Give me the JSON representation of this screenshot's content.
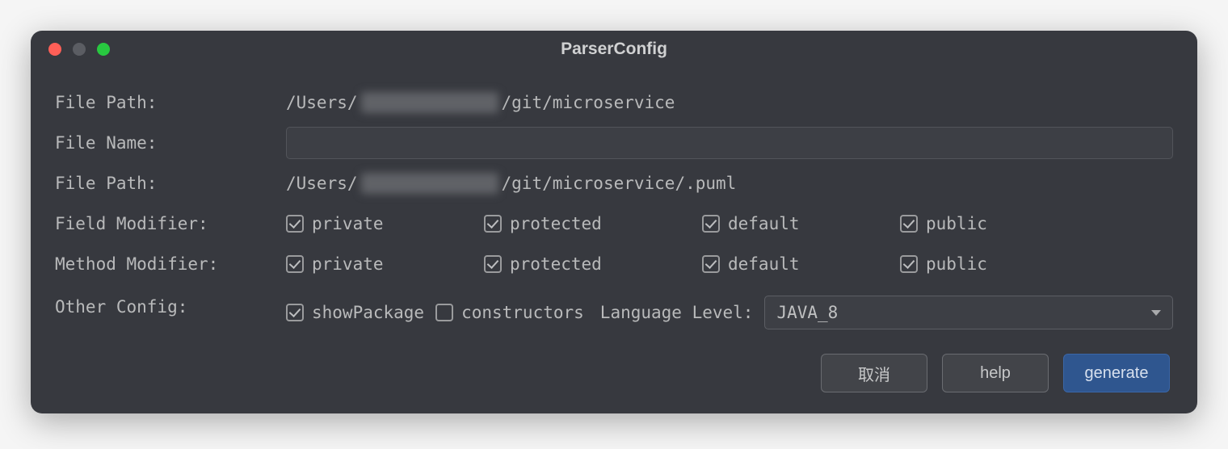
{
  "window": {
    "title": "ParserConfig"
  },
  "form": {
    "file_path_1": {
      "label": "File Path:",
      "prefix": "/Users/",
      "suffix": "/git/microservice"
    },
    "file_name": {
      "label": "File Name:",
      "value": ""
    },
    "file_path_2": {
      "label": "File Path:",
      "prefix": "/Users/",
      "suffix": "/git/microservice/.puml"
    },
    "field_modifier": {
      "label": "Field Modifier:",
      "options": [
        {
          "label": "private",
          "checked": true
        },
        {
          "label": "protected",
          "checked": true
        },
        {
          "label": "default",
          "checked": true
        },
        {
          "label": "public",
          "checked": true
        }
      ]
    },
    "method_modifier": {
      "label": "Method Modifier:",
      "options": [
        {
          "label": "private",
          "checked": true
        },
        {
          "label": "protected",
          "checked": true
        },
        {
          "label": "default",
          "checked": true
        },
        {
          "label": "public",
          "checked": true
        }
      ]
    },
    "other_config": {
      "label": "Other Config:",
      "show_package": {
        "label": "showPackage",
        "checked": true
      },
      "constructors": {
        "label": "constructors",
        "checked": false
      },
      "language_level": {
        "label": "Language Level:",
        "value": "JAVA_8"
      }
    }
  },
  "buttons": {
    "cancel": "取消",
    "help": "help",
    "generate": "generate"
  }
}
